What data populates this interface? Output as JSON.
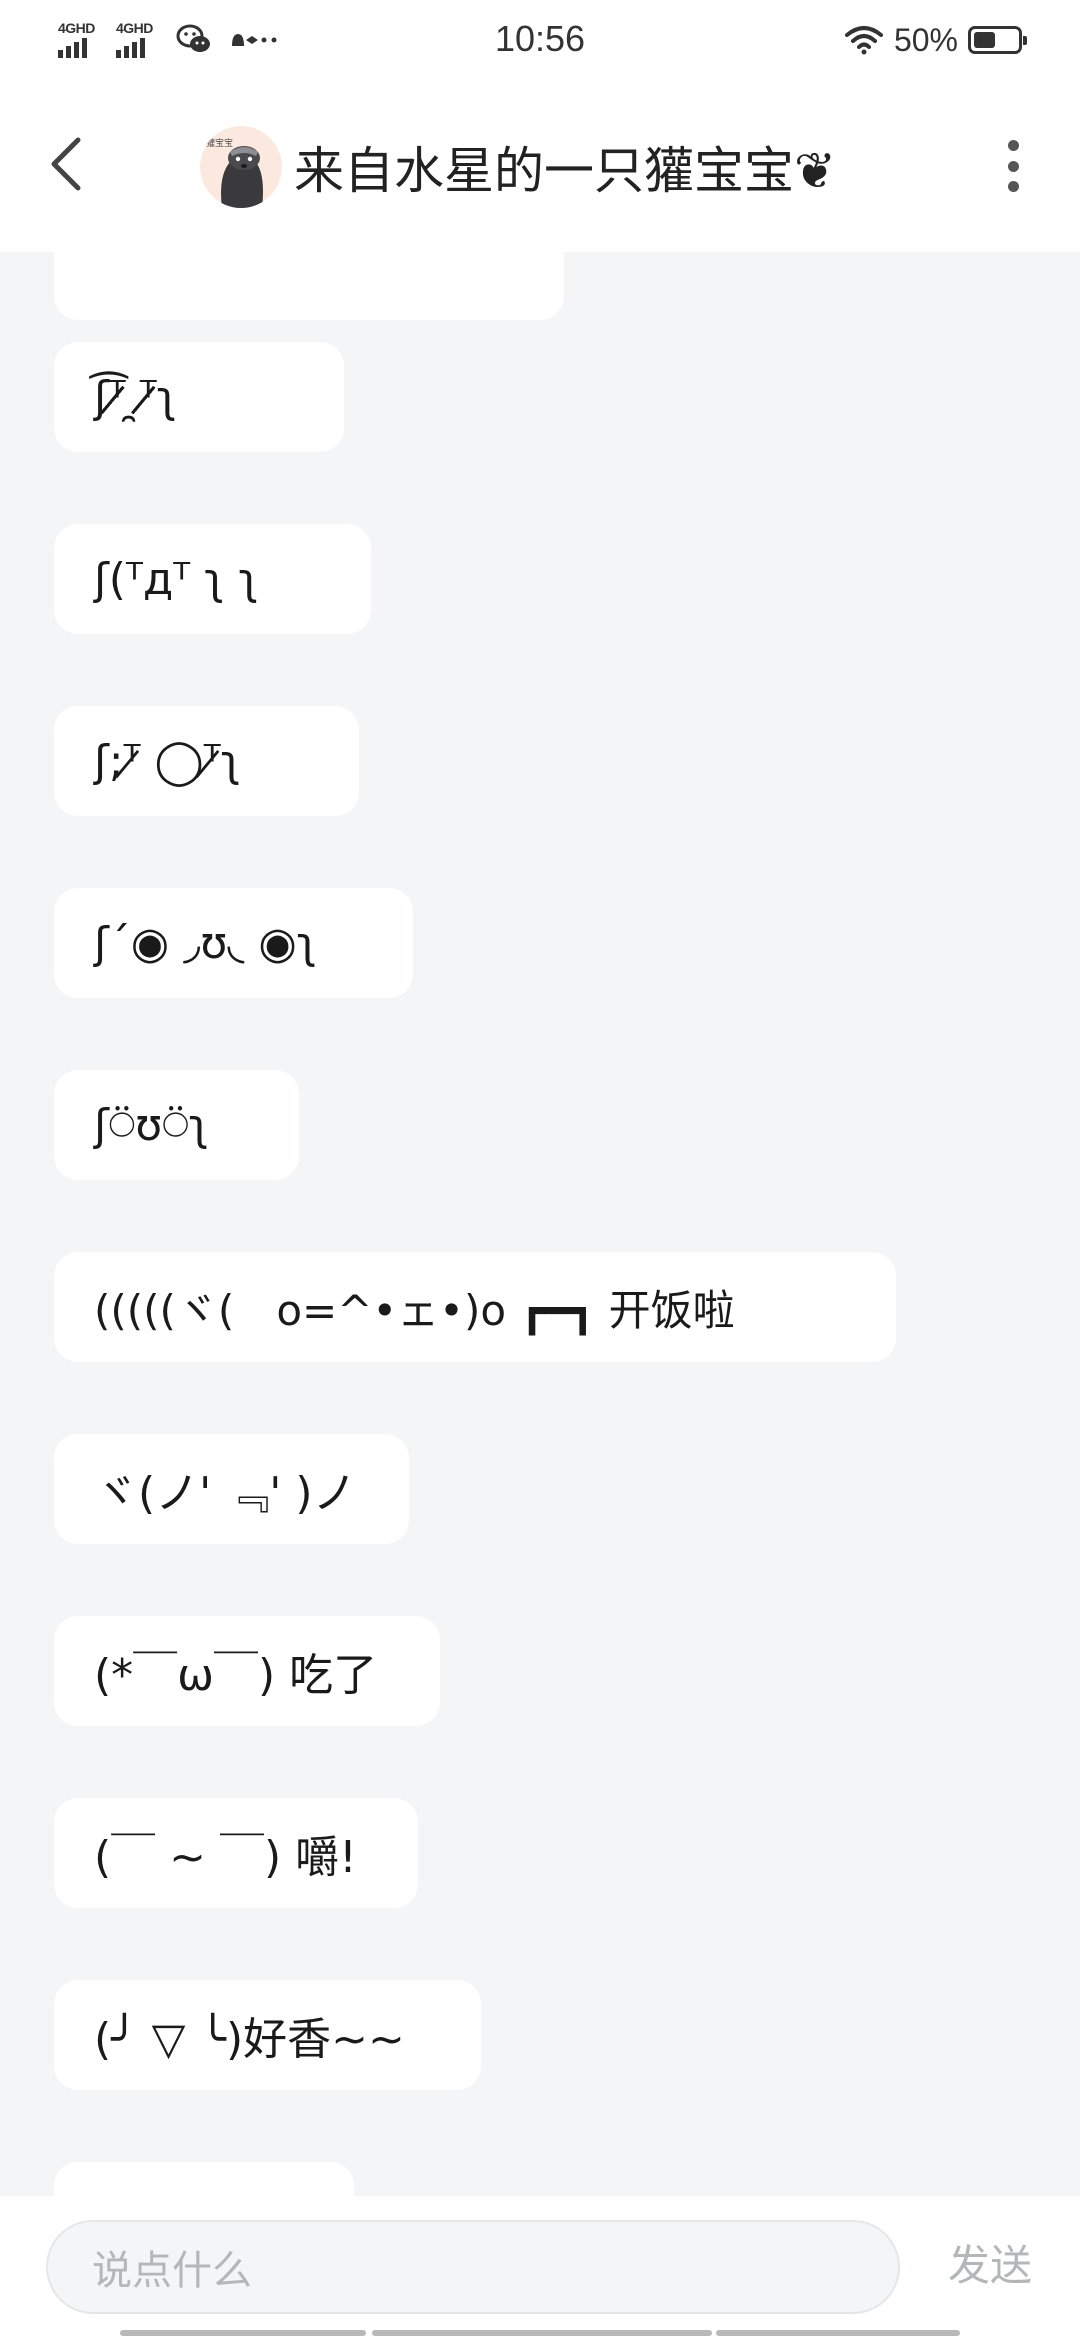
{
  "status_bar": {
    "network_1": "4GHD",
    "network_2": "4GHD",
    "time": "10:56",
    "battery_text": "50%",
    "battery_level": 0.5,
    "icons": [
      "signal-icon",
      "signal-icon",
      "wechat-icon",
      "notification-dots-icon",
      "wifi-icon",
      "battery-icon"
    ]
  },
  "header": {
    "title": "来自水星的一只獾宝宝❦",
    "avatar_text": "獾宝宝",
    "back_icon": "chevron-left-icon",
    "more_icon": "more-vertical-icon"
  },
  "messages": [
    {
      "text": "ʃ͡ᵀ̷̷̷̷̷̷̷̷̷̷̷̷̷̷̷̷̷̷ ̯ᵀ̷̷̷̷̷̷̷̷̷̷̷̷̷̷̷̷̷̷̷ʅ"
    },
    {
      "text": "ʃ(ᵀдᵀ ʅ ʅ"
    },
    {
      "text": "ʃ;ᵀ̷̷ ◯ᵀ̷̷ʅ"
    },
    {
      "text": "ʃ´◉ ◞ʊ◟ ◉ʅ"
    },
    {
      "text": "ʃ⍥ʊ⍥ʅ"
    },
    {
      "text": "(((((ヾ(　o=^•ェ•)o ┏━┓ 开饭啦"
    },
    {
      "text": "ヾ(ノ' ﹃' )ノ"
    },
    {
      "text": "(*￣ω￣) 吃了"
    },
    {
      "text": "(￣ ~ ￣) 嚼!"
    },
    {
      "text": "(╯ ▽ ╰)好香~~"
    }
  ],
  "input_bar": {
    "placeholder": "说点什么",
    "send_label": "发送"
  }
}
